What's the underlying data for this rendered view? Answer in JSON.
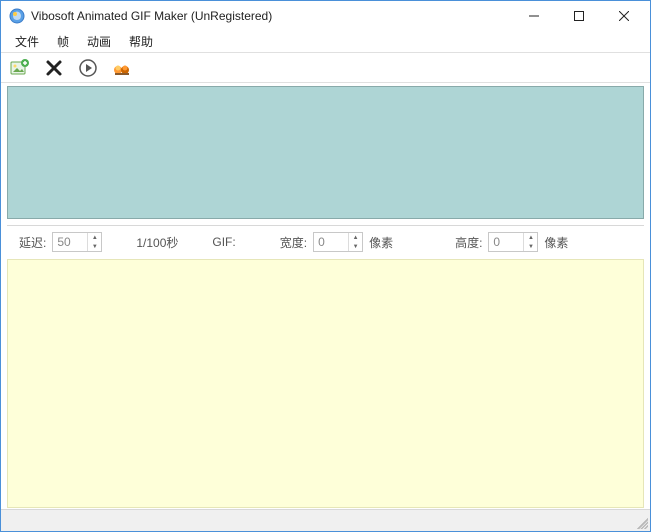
{
  "window": {
    "title": "Vibosoft Animated GIF Maker (UnRegistered)"
  },
  "menubar": {
    "items": [
      "文件",
      "帧",
      "动画",
      "帮助"
    ]
  },
  "toolbar": {
    "add_image": "add-image",
    "delete": "delete",
    "play": "play",
    "settings": "settings"
  },
  "params": {
    "delay_label": "延迟:",
    "delay_value": "50",
    "delay_unit": "1/100秒",
    "gif_label": "GIF:",
    "width_label": "宽度:",
    "width_value": "0",
    "width_unit": "像素",
    "height_label": "高度:",
    "height_value": "0",
    "height_unit": "像素"
  }
}
